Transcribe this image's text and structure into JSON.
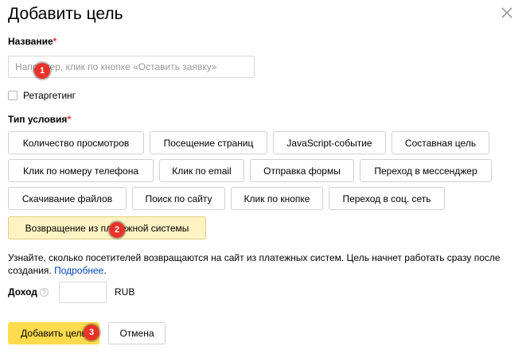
{
  "dialog": {
    "title": "Добавить цель",
    "close_icon": "close-icon"
  },
  "name_field": {
    "label": "Название",
    "required_mark": "*",
    "placeholder": "Например, клик по кнопке «Оставить заявку»"
  },
  "retargeting": {
    "label": "Ретаргетинг",
    "checked": false
  },
  "condition_type": {
    "label": "Тип условия",
    "required_mark": "*",
    "options": [
      "Количество просмотров",
      "Посещение страниц",
      "JavaScript-событие",
      "Составная цель",
      "Клик по номеру телефона",
      "Клик по email",
      "Отправка формы",
      "Переход в мессенджер",
      "Скачивание файлов",
      "Поиск по сайту",
      "Клик по кнопке",
      "Переход в соц. сеть",
      "Возвращение из платежной системы"
    ],
    "selected": "Возвращение из платежной системы"
  },
  "hint": {
    "text": "Узнайте, сколько посетителей возвращаются на сайт из платежных систем. Цель начнет работать сразу после создания. ",
    "link": "Подробнее",
    "suffix": "."
  },
  "income": {
    "label": "Доход",
    "help_icon": "?",
    "value": "",
    "currency": "RUB"
  },
  "actions": {
    "submit": "Добавить цель",
    "cancel": "Отмена"
  },
  "annotations": [
    "1",
    "2",
    "3"
  ],
  "colors": {
    "primary": "#ffdb4d",
    "selected_bg": "#fff3c4",
    "badge": "#e8332a",
    "required": "#e52d2d",
    "link": "#0044bb"
  }
}
